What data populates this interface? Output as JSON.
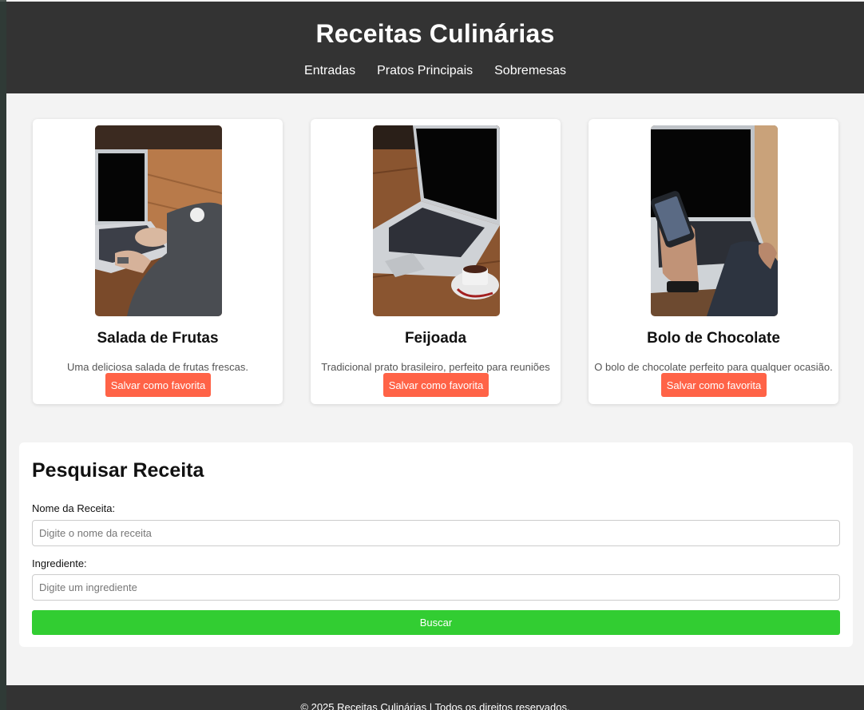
{
  "header": {
    "title": "Receitas Culinárias",
    "nav": [
      "Entradas",
      "Pratos Principais",
      "Sobremesas"
    ]
  },
  "recipes": [
    {
      "title": "Salada de Frutas",
      "description": "Uma deliciosa salada de frutas frescas.",
      "button": "Salvar como favorita",
      "image_icon": "laptop-typing-photo"
    },
    {
      "title": "Feijoada",
      "description": "Tradicional prato brasileiro, perfeito para reuniões",
      "button": "Salvar como favorita",
      "image_icon": "laptop-coffee-photo"
    },
    {
      "title": "Bolo de Chocolate",
      "description": "O bolo de chocolate perfeito para qualquer ocasião.",
      "button": "Salvar como favorita",
      "image_icon": "phone-laptop-photo"
    }
  ],
  "search": {
    "title": "Pesquisar Receita",
    "name_label": "Nome da Receita:",
    "name_placeholder": "Digite o nome da receita",
    "ingredient_label": "Ingrediente:",
    "ingredient_placeholder": "Digite um ingrediente",
    "submit_label": "Buscar"
  },
  "footer": {
    "text": "© 2025 Receitas Culinárias | Todos os direitos reservados."
  },
  "colors": {
    "header_bg": "#333333",
    "favorite_button": "#ff6347",
    "search_button": "#32cd32",
    "page_bg": "#f3f3f3"
  }
}
